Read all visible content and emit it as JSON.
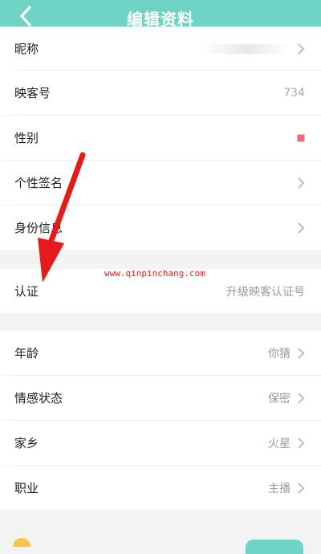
{
  "header": {
    "title": "编辑资料",
    "accent": "#6fd3c5"
  },
  "rows": {
    "nickname": {
      "label": "昵称"
    },
    "id": {
      "label": "映客号",
      "value": "734"
    },
    "gender": {
      "label": "性别"
    },
    "signature": {
      "label": "个性签名"
    },
    "identity": {
      "label": "身份信息"
    },
    "certify": {
      "label": "认证",
      "value": "升级映客认证号"
    },
    "age": {
      "label": "年龄",
      "value": "你猜"
    },
    "emotion": {
      "label": "情感状态",
      "value": "保密"
    },
    "hometown": {
      "label": "家乡",
      "value": "火星"
    },
    "job": {
      "label": "职业",
      "value": "主播"
    }
  },
  "watermark": {
    "text": "www.qinpinchang.com"
  },
  "icons": {
    "back": "back-arrow-icon",
    "chevron": "chevron-right-icon",
    "gender": "gender-icon"
  }
}
